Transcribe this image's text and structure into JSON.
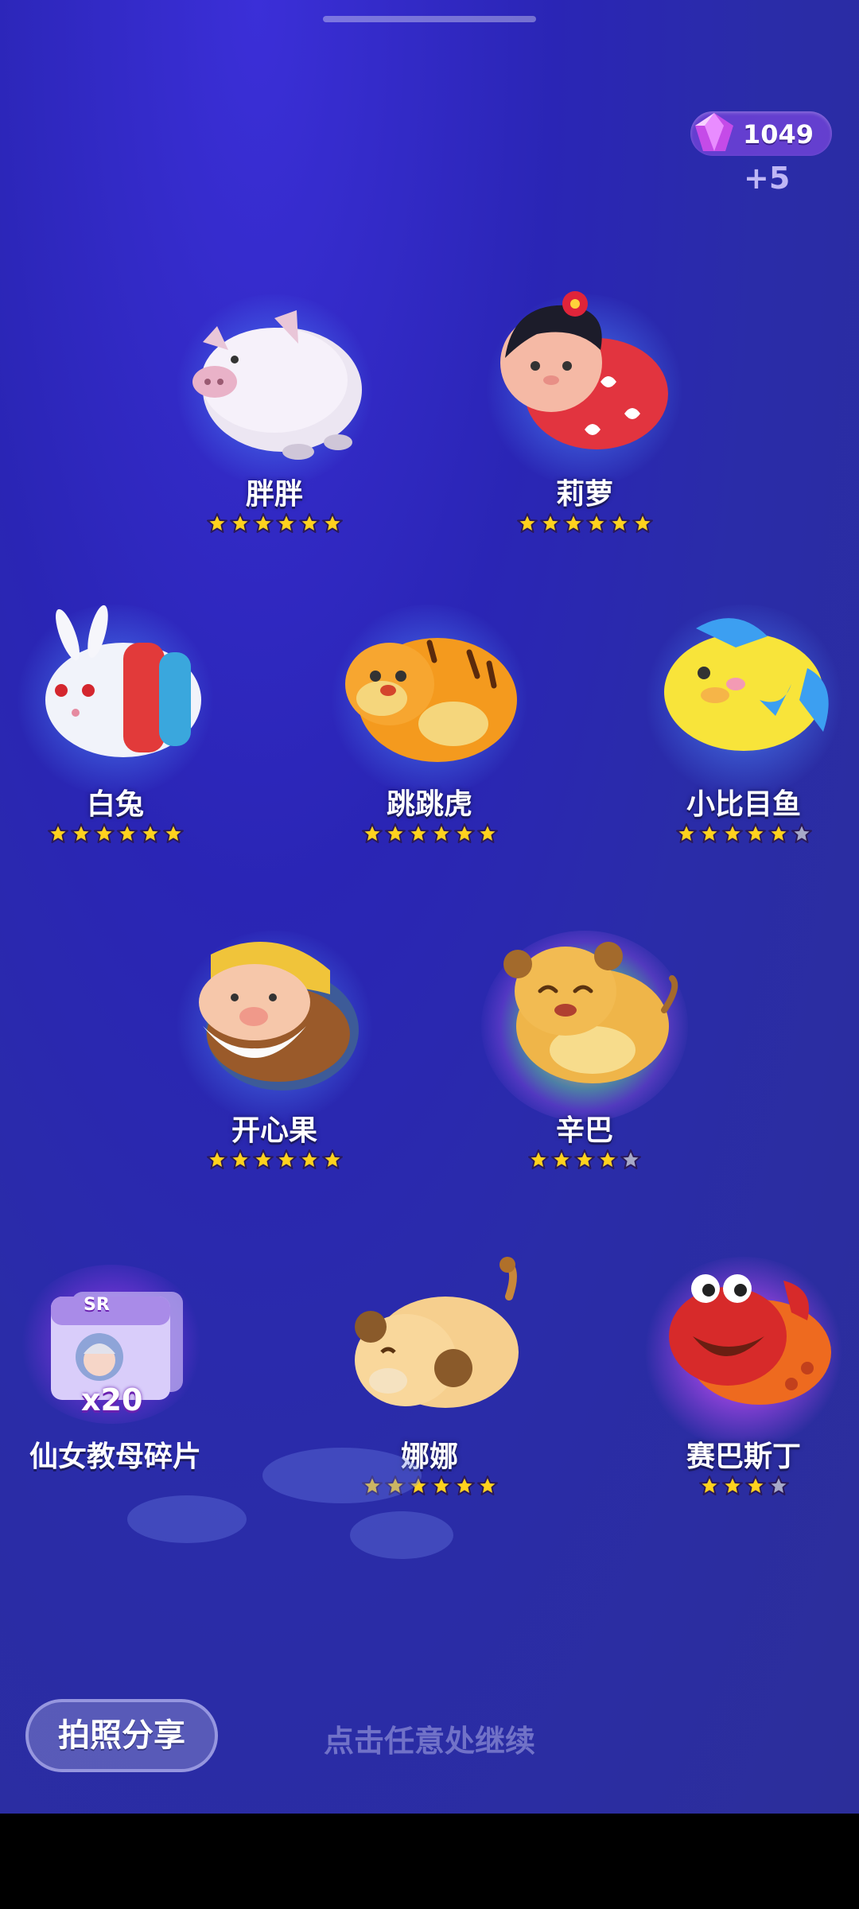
{
  "currency": {
    "icon": "gem-icon",
    "amount": "1049",
    "bonus": "+5"
  },
  "characters": [
    {
      "name": "胖胖",
      "stars": 6,
      "max_stars": 6,
      "icon": "pig-tsum-icon",
      "glow": "blue"
    },
    {
      "name": "莉萝",
      "stars": 6,
      "max_stars": 6,
      "icon": "lilo-tsum-icon",
      "glow": "blue"
    },
    {
      "name": "白兔",
      "stars": 6,
      "max_stars": 6,
      "icon": "white-rabbit-tsum-icon",
      "glow": "blue"
    },
    {
      "name": "跳跳虎",
      "stars": 6,
      "max_stars": 6,
      "icon": "tigger-tsum-icon",
      "glow": "blue"
    },
    {
      "name": "小比目鱼",
      "stars": 5,
      "max_stars": 6,
      "icon": "flounder-tsum-icon",
      "glow": "blue"
    },
    {
      "name": "开心果",
      "stars": 6,
      "max_stars": 6,
      "icon": "dwarf-tsum-icon",
      "glow": "blue"
    },
    {
      "name": "辛巴",
      "stars": 4,
      "max_stars": 5,
      "icon": "simba-tsum-icon",
      "glow": "rainbow"
    },
    {
      "name": "娜娜",
      "stars": 6,
      "max_stars": 6,
      "icon": "nala-tsum-icon",
      "glow": "none"
    },
    {
      "name": "赛巴斯丁",
      "stars": 3,
      "max_stars": 4,
      "icon": "sebastian-tsum-icon",
      "glow": "purple"
    }
  ],
  "fragment": {
    "name": "仙女教母碎片",
    "count": "x20",
    "rarity": "SR",
    "icon": "fairy-godmother-card-icon"
  },
  "footer": {
    "share_label": "拍照分享",
    "continue_hint": "点击任意处继续"
  },
  "colors": {
    "background": "#2a2ca8",
    "star_on": "#ffd21e",
    "star_off": "#a7a9c8"
  }
}
